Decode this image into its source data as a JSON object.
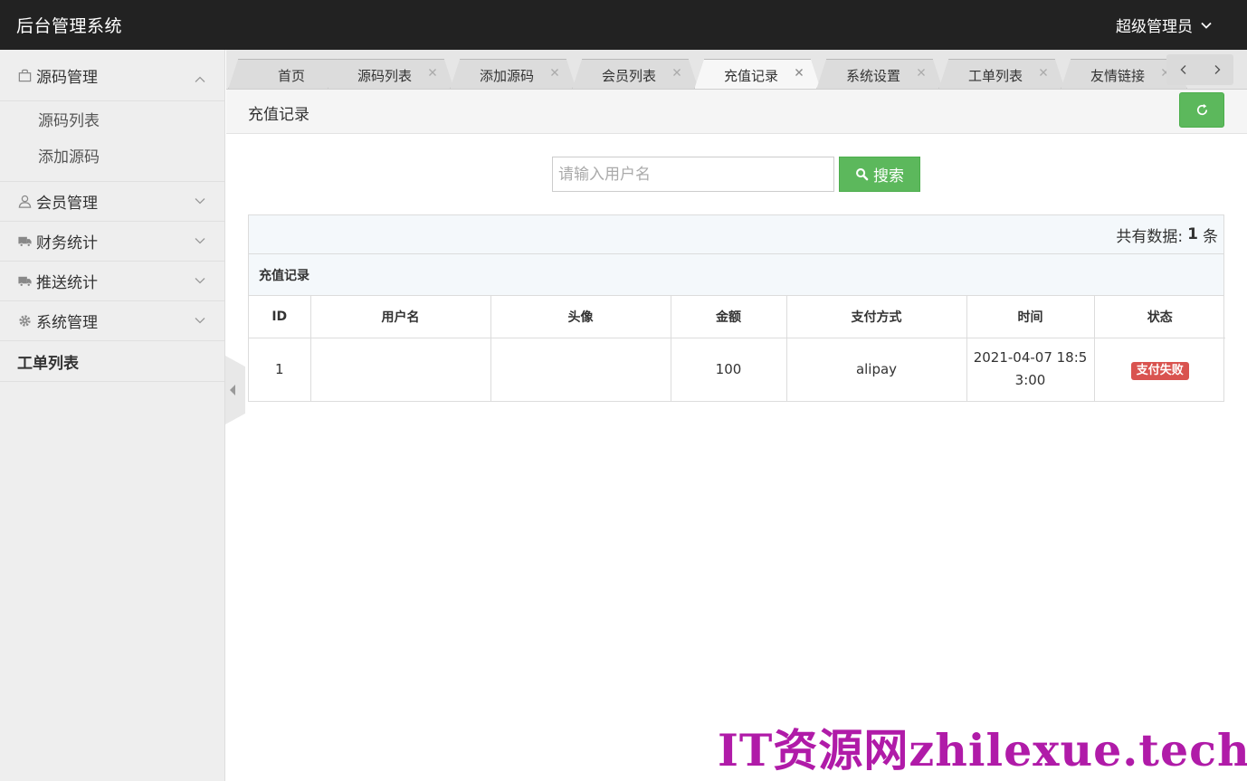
{
  "header": {
    "app_title": "后台管理系统",
    "user_label": "超级管理员"
  },
  "sidebar": {
    "groups": [
      {
        "label": "源码管理",
        "icon": "bag-icon",
        "expanded": true,
        "items": [
          "源码列表",
          "添加源码"
        ]
      },
      {
        "label": "会员管理",
        "icon": "user-icon",
        "expanded": false
      },
      {
        "label": "财务统计",
        "icon": "truck-icon",
        "expanded": false
      },
      {
        "label": "推送统计",
        "icon": "truck-icon",
        "expanded": false
      },
      {
        "label": "系统管理",
        "icon": "gear-icon",
        "expanded": false
      }
    ],
    "plain_item": "工单列表"
  },
  "tabs": [
    {
      "label": "首页",
      "closable": false,
      "active": false
    },
    {
      "label": "源码列表",
      "closable": true,
      "active": false
    },
    {
      "label": "添加源码",
      "closable": true,
      "active": false
    },
    {
      "label": "会员列表",
      "closable": true,
      "active": false
    },
    {
      "label": "充值记录",
      "closable": true,
      "active": true
    },
    {
      "label": "系统设置",
      "closable": true,
      "active": false
    },
    {
      "label": "工单列表",
      "closable": true,
      "active": false
    },
    {
      "label": "友情链接",
      "closable": true,
      "active": false
    }
  ],
  "page": {
    "title": "充值记录"
  },
  "search": {
    "placeholder": "请输入用户名",
    "button_label": "搜索"
  },
  "summary": {
    "prefix": "共有数据:",
    "count": "1",
    "suffix": "条"
  },
  "table": {
    "caption": "充值记录",
    "columns": [
      "ID",
      "用户名",
      "头像",
      "金额",
      "支付方式",
      "时间",
      "状态"
    ],
    "rows": [
      {
        "id": "1",
        "username": "",
        "avatar": "",
        "amount": "100",
        "pay_method": "alipay",
        "time": "2021-04-07 18:53:00",
        "status": "支付失败"
      }
    ]
  },
  "watermark": "IT资源网zhilexue.tech",
  "colors": {
    "header_bg": "#222222",
    "sidebar_bg": "#eeeeee",
    "success_green": "#5cb85c",
    "danger_red": "#d9534f",
    "watermark": "#b01ba8"
  }
}
